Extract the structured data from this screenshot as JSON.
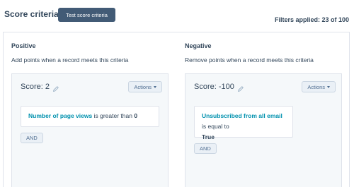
{
  "header": {
    "title": "Score criteria",
    "test_button_label": "Test score criteria",
    "filters_applied": "Filters applied: 23 of 100"
  },
  "positive": {
    "heading": "Positive",
    "description": "Add points when a record meets this criteria",
    "score_label": "Score: 2",
    "actions_label": "Actions",
    "criterion": {
      "property": "Number of page views",
      "operator": "is greater than",
      "value": "0"
    },
    "and_label": "AND"
  },
  "negative": {
    "heading": "Negative",
    "description": "Remove points when a record meets this criteria",
    "score_label": "Score: -100",
    "actions_label": "Actions",
    "criterion": {
      "property": "Unsubscribed from all email",
      "operator": "is equal to",
      "value": "True"
    },
    "and_label": "AND"
  },
  "icons": {
    "edit": "pencil-icon",
    "dropdown": "caret-down-icon"
  },
  "colors": {
    "primary_button": "#425b76",
    "link": "#0091ae",
    "text": "#33475b",
    "panel_bg": "#f5f8fa",
    "border": "#dfe3eb"
  }
}
